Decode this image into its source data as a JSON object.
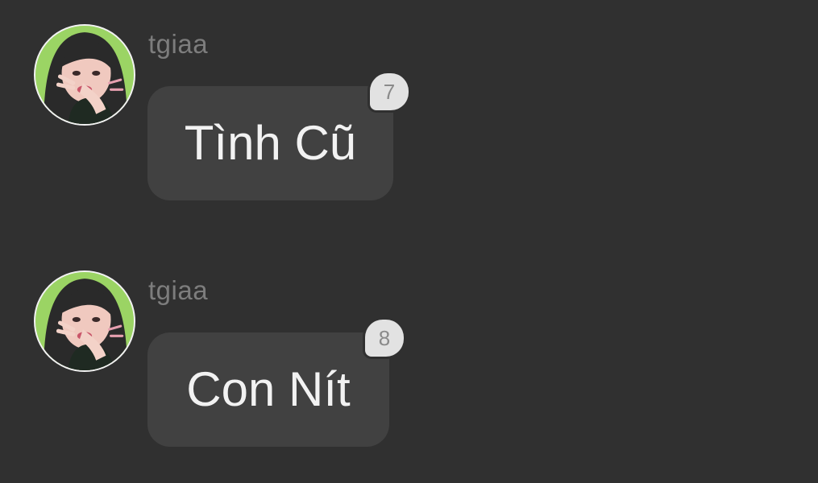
{
  "colors": {
    "background": "#303030",
    "bubble": "#414141",
    "username": "#7d7d7d",
    "message_text": "#f2f2f2",
    "badge_bg": "#e2e2e2",
    "badge_text": "#8a8a8a",
    "avatar_background": "#9bd464"
  },
  "messages": [
    {
      "username": "tgiaa",
      "text": "Tình Cũ",
      "count": "7",
      "avatar_icon": "user-avatar-photo"
    },
    {
      "username": "tgiaa",
      "text": "Con Nít",
      "count": "8",
      "avatar_icon": "user-avatar-photo"
    }
  ]
}
